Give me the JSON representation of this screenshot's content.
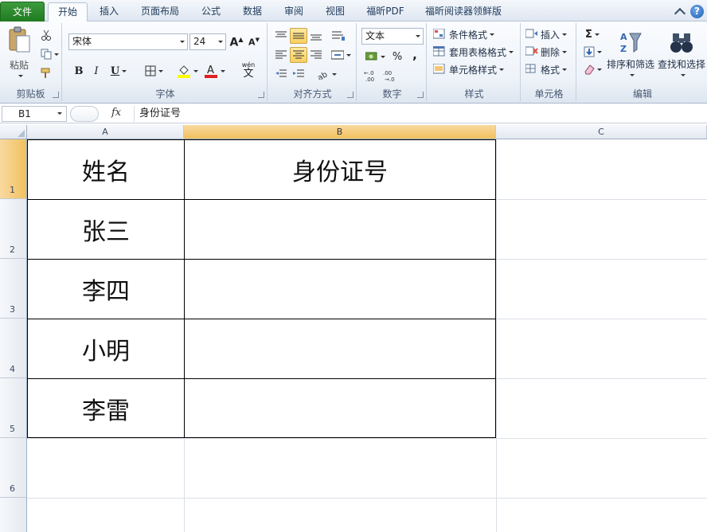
{
  "tabs": [
    {
      "label": "文件",
      "kind": "file"
    },
    {
      "label": "开始",
      "kind": "active"
    },
    {
      "label": "插入"
    },
    {
      "label": "页面布局"
    },
    {
      "label": "公式"
    },
    {
      "label": "数据"
    },
    {
      "label": "审阅"
    },
    {
      "label": "视图"
    },
    {
      "label": "福昕PDF"
    },
    {
      "label": "福昕阅读器领鲜版"
    }
  ],
  "ribbon": {
    "clipboard": {
      "label": "剪贴板",
      "paste": "粘贴"
    },
    "font": {
      "label": "字体",
      "name": "宋体",
      "size": "24",
      "bold": "B",
      "italic": "I",
      "underline": "U",
      "wen": "wén",
      "wen_char": "文"
    },
    "alignment": {
      "label": "对齐方式"
    },
    "number": {
      "label": "数字",
      "format": "文本",
      "percent": "%",
      "comma": ","
    },
    "styles": {
      "label": "样式",
      "conditional": "条件格式",
      "table_format": "套用表格格式",
      "cell_style": "单元格样式"
    },
    "cells": {
      "label": "单元格",
      "insert": "插入",
      "delete": "删除",
      "format": "格式"
    },
    "editing": {
      "label": "编辑",
      "sigma": "Σ",
      "sort_filter": "排序和筛选",
      "find_select": "查找和选择"
    }
  },
  "formula_bar": {
    "name_box": "B1",
    "fx": "fx",
    "content": "身份证号"
  },
  "sheet": {
    "columns": [
      "A",
      "B",
      "C"
    ],
    "rows": [
      "1",
      "2",
      "3",
      "4",
      "5",
      "6"
    ],
    "cells": [
      {
        "a": "姓名",
        "b": "身份证号"
      },
      {
        "a": "张三",
        "b": ""
      },
      {
        "a": "李四",
        "b": ""
      },
      {
        "a": "小明",
        "b": ""
      },
      {
        "a": "李雷",
        "b": ""
      }
    ]
  },
  "colors": {
    "file_tab": "#2a862a",
    "accent_highlight": "#f8cf61",
    "selected_header": "#f1c15f"
  }
}
